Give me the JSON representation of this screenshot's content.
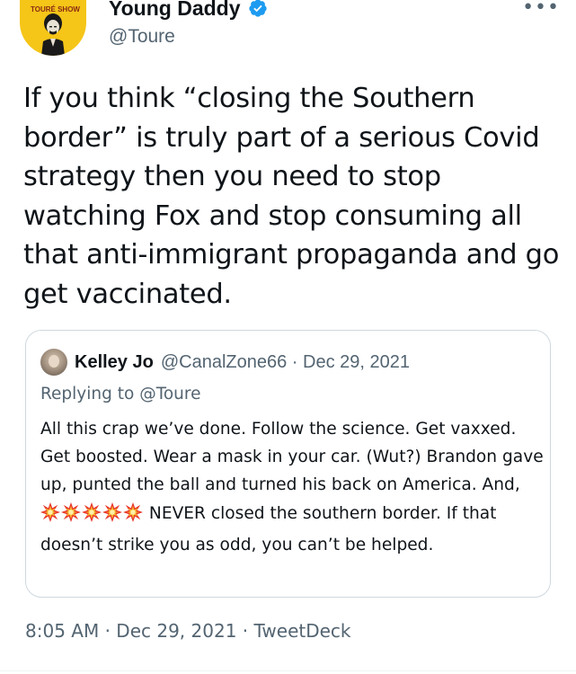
{
  "author": {
    "avatar_label": "TOURÉ SHOW",
    "display_name": "Young Daddy",
    "handle": "@Toure",
    "verified": true
  },
  "tweet": {
    "text": "If you think “closing the Southern border” is truly part of a serious Covid strategy then you need to stop watching Fox and stop consuming all that anti-immigrant propaganda and go get vaccinated."
  },
  "quoted_tweet": {
    "display_name": "Kelley Jo",
    "handle": "@CanalZone66",
    "separator": " · ",
    "date": "Dec 29, 2021",
    "replying_prefix": "Replying to ",
    "replying_handle": "@Toure",
    "text_before_emoji": "All this crap we’ve done. Follow the science. Get vaxxed. Get boosted. Wear a mask in your car. (Wut?) Brandon gave up, punted the ball and turned his back on America. And, ",
    "emoji_count": 5,
    "emoji_name": "collision-icon",
    "text_after_emoji": " NEVER closed the southern border. If that doesn’t strike you as odd, you can’t be helped."
  },
  "footer": {
    "time": "8:05 AM",
    "separator": " · ",
    "date": "Dec 29, 2021",
    "source": "TweetDeck"
  },
  "colors": {
    "text_primary": "#0f1419",
    "text_secondary": "#536471",
    "verified_blue": "#1d9bf0",
    "card_border": "#cfd9de",
    "avatar_bg": "#f5c518"
  }
}
